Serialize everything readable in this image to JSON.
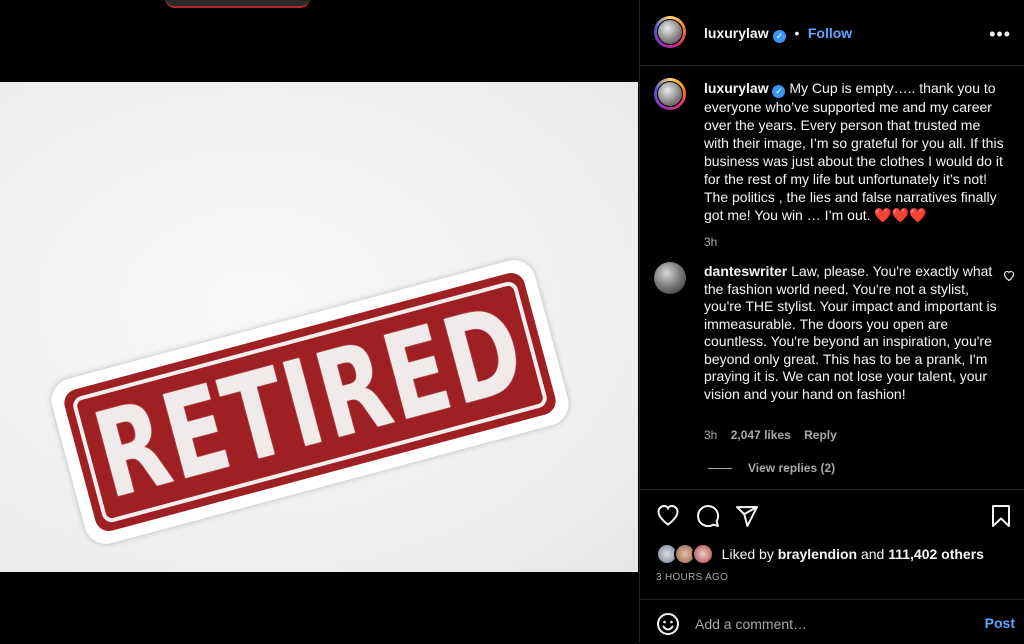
{
  "media": {
    "sticker_text": "RETIRED",
    "brand_red": "#9e2023"
  },
  "header": {
    "username": "luxurylaw",
    "separator": "•",
    "follow_label": "Follow",
    "more_icon": "more-horizontal-icon",
    "more_glyph": "•••"
  },
  "caption": {
    "username": "luxurylaw",
    "text": "My Cup is empty….. thank you to everyone who’ve supported me and my career over the years. Every person that trusted me with their image, I’m so grateful for you all. If this business was just about the clothes I would do it for the rest of my life but unfortunately it’s not! The politics , the lies and false narratives finally got me! You win … I’m out. ❤️❤️❤️",
    "time": "3h"
  },
  "comment": {
    "username": "danteswriter",
    "text": "Law, please. You're exactly what the fashion world need. You're not a stylist, you're THE stylist. Your impact and important is immeasurable. The doors you open are countless. You're beyond an inspiration, you're beyond only great. This has to be a prank, I'm praying it is. We can not lose your talent, your vision and your hand on fashion!",
    "time": "3h",
    "likes": "2,047 likes",
    "reply_label": "Reply",
    "view_replies": "View replies (2)",
    "like_icon": "heart-outline-icon"
  },
  "actions": {
    "like_icon": "heart-icon",
    "comment_icon": "comment-icon",
    "share_icon": "share-icon",
    "save_icon": "bookmark-icon",
    "liked_by_prefix": "Liked by",
    "liked_by_user": "braylendion",
    "and_label": "and",
    "others": "111,402 others",
    "time_ago": "3 HOURS AGO"
  },
  "comment_bar": {
    "emoji_icon": "emoji-icon",
    "placeholder": "Add a comment…",
    "post_label": "Post"
  }
}
